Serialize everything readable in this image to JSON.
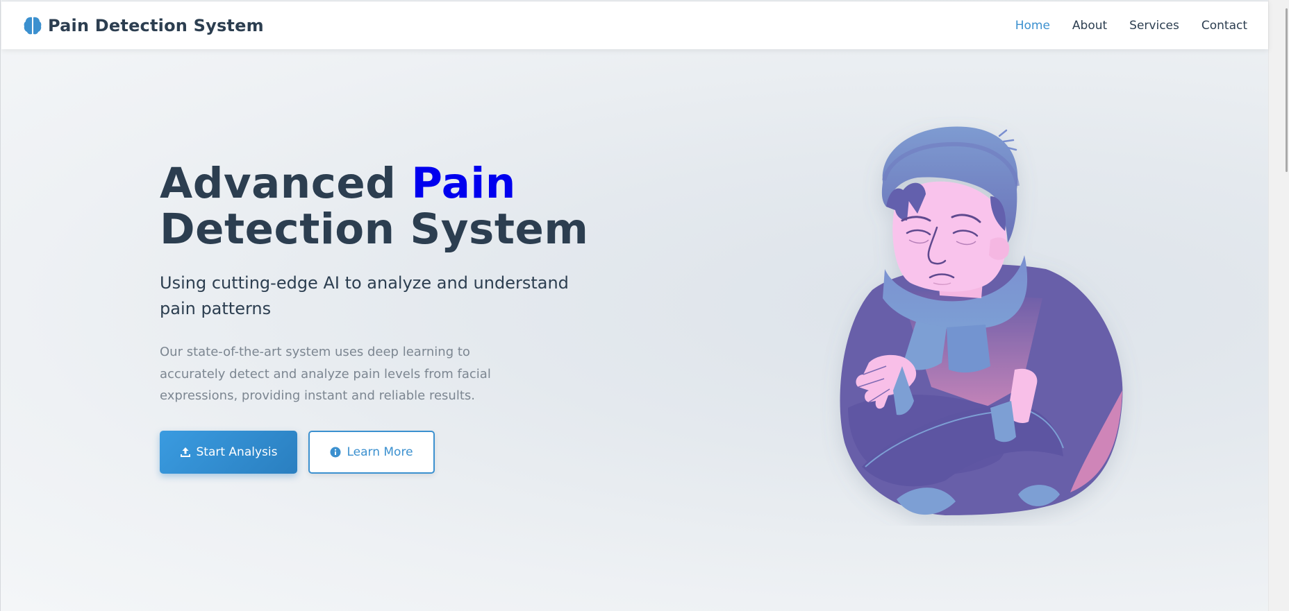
{
  "app": {
    "brand": "Pain Detection System",
    "brand_icon": "brain-icon"
  },
  "nav": {
    "links": [
      "Home",
      "About",
      "Services",
      "Contact"
    ],
    "active": "Home"
  },
  "hero": {
    "title_part1": "Advanced",
    "title_accent": "Pain",
    "title_part2": "Detection System",
    "subtitle": "Using cutting-edge AI to analyze and understand pain patterns",
    "description": "Our state-of-the-art system uses deep learning to accurately detect and analyze pain levels from facial expressions, providing instant and reliable results.",
    "primary_button": "Start Analysis",
    "primary_icon": "upload-icon",
    "secondary_button": "Learn More",
    "secondary_icon": "info-circle-icon"
  },
  "colors": {
    "accent": "#3b90cf",
    "title_accent": "#0000ee",
    "text_dark": "#2c3e50",
    "text_muted": "#7c8691"
  }
}
